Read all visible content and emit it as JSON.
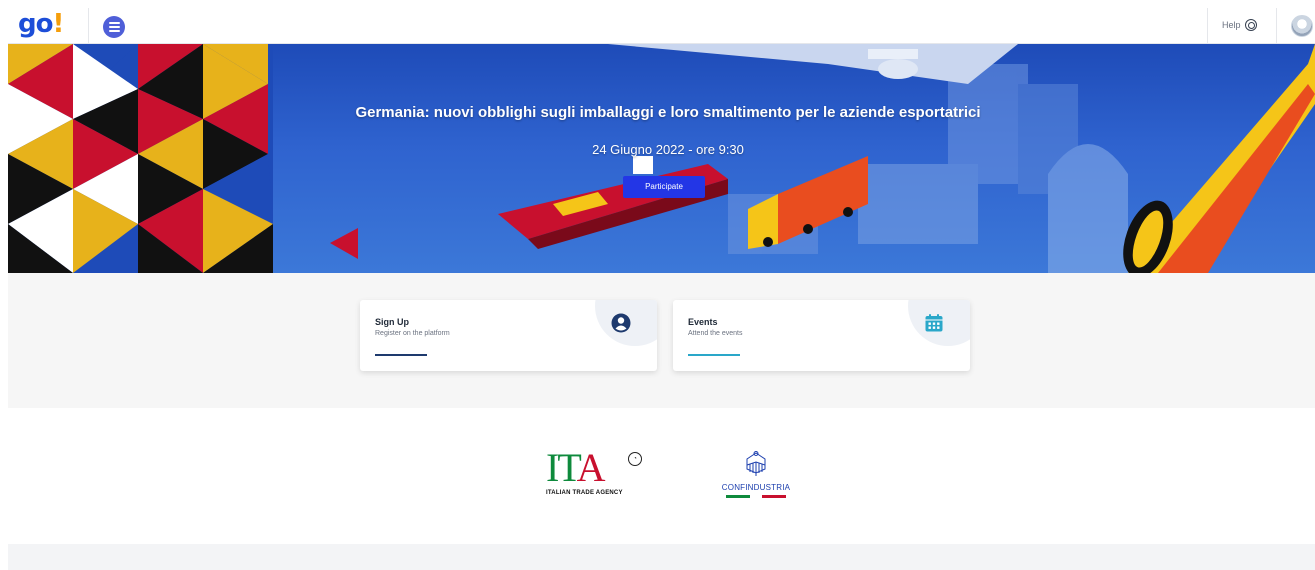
{
  "header": {
    "logo": {
      "g": "g",
      "o": "o",
      "ex": "!"
    },
    "menu_icon": "hamburger-menu-icon",
    "help_label": "Help",
    "help_icon": "lifebuoy-icon",
    "avatar_icon": "user-avatar-icon"
  },
  "hero": {
    "title": "Germania: nuovi obblighi sugli imballaggi e loro smaltimento per le aziende esportatrici",
    "date": "24 Giugno 2022 - ore 9:30",
    "button_label": "Participate"
  },
  "cards": [
    {
      "title": "Sign Up",
      "subtitle": "Register on the platform",
      "icon": "user-circle-icon",
      "accent": "#1e3a6e"
    },
    {
      "title": "Events",
      "subtitle": "Attend the events",
      "icon": "calendar-icon",
      "accent": "#2aa7c9"
    }
  ],
  "partners": {
    "ita": {
      "mark": "ITA",
      "badge": "ITA",
      "subtitle": "ITALIAN TRADE AGENCY"
    },
    "confindustria": {
      "name": "CONFINDUSTRIA"
    }
  },
  "colors": {
    "brand_blue": "#1d4ed8",
    "brand_orange": "#f59e0b",
    "button_blue": "#2336e6",
    "italy_green": "#0e8a3c",
    "italy_red": "#c8102e"
  }
}
